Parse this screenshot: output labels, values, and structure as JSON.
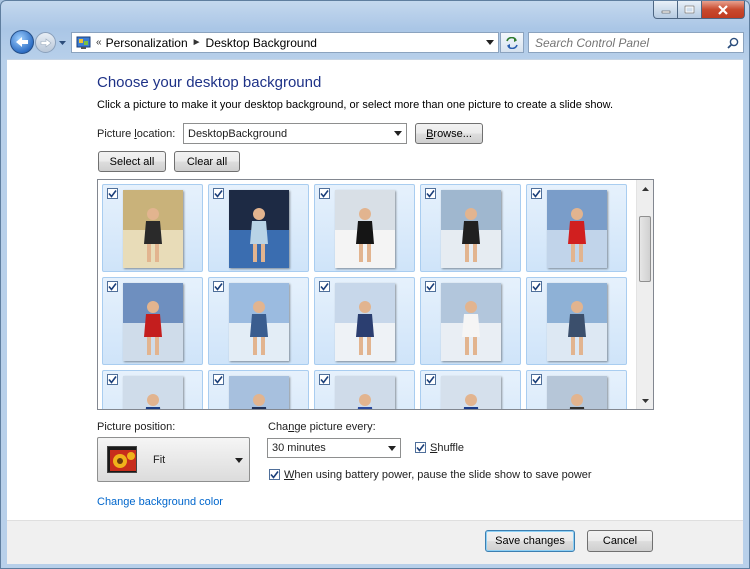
{
  "nav": {
    "crumbs": [
      "Personalization",
      "Desktop Background"
    ],
    "search_placeholder": "Search Control Panel"
  },
  "main": {
    "heading": "Choose your desktop background",
    "subtext": "Click a picture to make it your desktop background, or select more than one picture to create a slide show.",
    "location_label_pre": "Picture ",
    "location_label_accel": "l",
    "location_label_post": "ocation:",
    "location_value": "DesktopBackground",
    "browse_label_accel": "B",
    "browse_label_post": "rowse...",
    "select_all_label": "Select all",
    "clear_all_label": "Clear all"
  },
  "gallery": {
    "tiles": [
      {
        "checked": true,
        "icon": "photo-icon"
      },
      {
        "checked": true,
        "icon": "photo-icon"
      },
      {
        "checked": true,
        "icon": "photo-icon"
      },
      {
        "checked": true,
        "icon": "photo-icon"
      },
      {
        "checked": true,
        "icon": "photo-icon"
      },
      {
        "checked": true,
        "icon": "photo-icon"
      },
      {
        "checked": true,
        "icon": "photo-icon"
      },
      {
        "checked": true,
        "icon": "photo-icon"
      },
      {
        "checked": true,
        "icon": "photo-icon"
      },
      {
        "checked": true,
        "icon": "photo-icon"
      },
      {
        "checked": true,
        "icon": "photo-icon"
      },
      {
        "checked": true,
        "icon": "photo-icon"
      },
      {
        "checked": true,
        "icon": "photo-icon"
      },
      {
        "checked": true,
        "icon": "photo-icon"
      },
      {
        "checked": true,
        "icon": "photo-icon"
      }
    ]
  },
  "options": {
    "position_label": "Picture position:",
    "position_value": "Fit",
    "change_label_pre": "Cha",
    "change_label_accel": "n",
    "change_label_post": "ge picture every:",
    "interval_value": "30 minutes",
    "shuffle_label_accel": "S",
    "shuffle_label_post": "huffle",
    "shuffle_checked": true,
    "battery_label_accel": "W",
    "battery_label_post": "hen using battery power, pause the slide show to save power",
    "battery_checked": true,
    "bg_color_link": "Change background color"
  },
  "footer": {
    "save_label": "Save changes",
    "cancel_label": "Cancel"
  },
  "colors": {
    "heading": "#1e3287",
    "link": "#0066cc",
    "tile_bg": "#cfe4f9"
  }
}
